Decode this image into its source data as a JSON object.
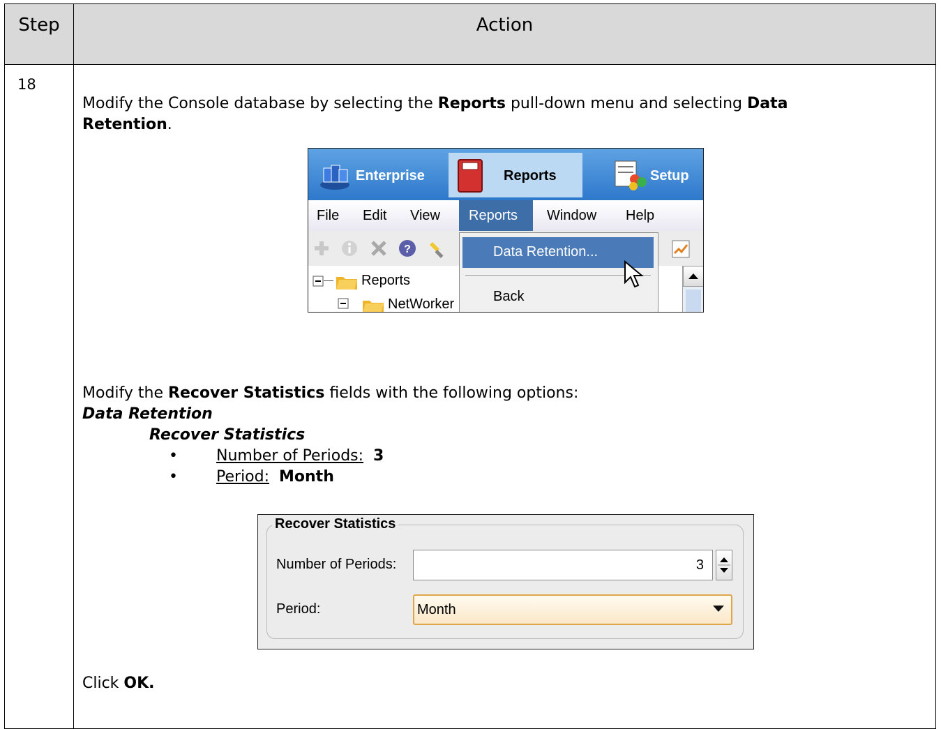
{
  "table": {
    "header_step": "Step",
    "header_action": "Action",
    "step_number": "18"
  },
  "instructions": {
    "line1_pre": "Modify the Console database by selecting the ",
    "line1_bold1": "Reports",
    "line1_mid": " pull-down menu and selecting ",
    "line1_bold2": "Data",
    "line2_bold": "Retention",
    "line2_post": ".",
    "modify_pre": "Modify the ",
    "modify_bold": "Recover Statistics",
    "modify_post": " fields with the following options:",
    "section1": "Data Retention",
    "section2": "Recover Statistics",
    "bullet1_label": "Number of Periods:",
    "bullet1_value": "3",
    "bullet2_label": "Period:",
    "bullet2_value": "Month",
    "click_pre": "Click ",
    "click_bold": "OK."
  },
  "console_screenshot": {
    "nav": [
      "Enterprise",
      "Reports",
      "Setup"
    ],
    "menu": [
      "File",
      "Edit",
      "View",
      "Reports",
      "Window",
      "Help"
    ],
    "dropdown": [
      "Data Retention...",
      "Back"
    ],
    "tree": [
      "Reports",
      "NetWorker"
    ]
  },
  "recover_dialog": {
    "title": "Recover Statistics",
    "periods_label": "Number of Periods:",
    "periods_value": "3",
    "period_label": "Period:",
    "period_value": "Month"
  }
}
